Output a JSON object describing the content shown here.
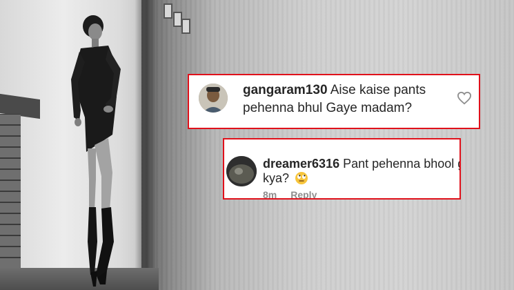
{
  "comments": [
    {
      "username": "gangaram130",
      "text_line1": "Aise kaise pants",
      "text_line2": "pehenna bhul Gaye madam?",
      "like_icon": "heart-outline-icon"
    },
    {
      "username": "dreamer6316",
      "text_line1": "Pant pehenna bhool gayi",
      "text_line2": "kya?",
      "emoji_icon": "face-with-rolling-eyes-icon",
      "time": "8m",
      "reply_label": "Reply"
    }
  ],
  "colors": {
    "highlight_border": "#e0101a",
    "comment_text": "#262626",
    "meta_text": "#8e8e8e"
  }
}
